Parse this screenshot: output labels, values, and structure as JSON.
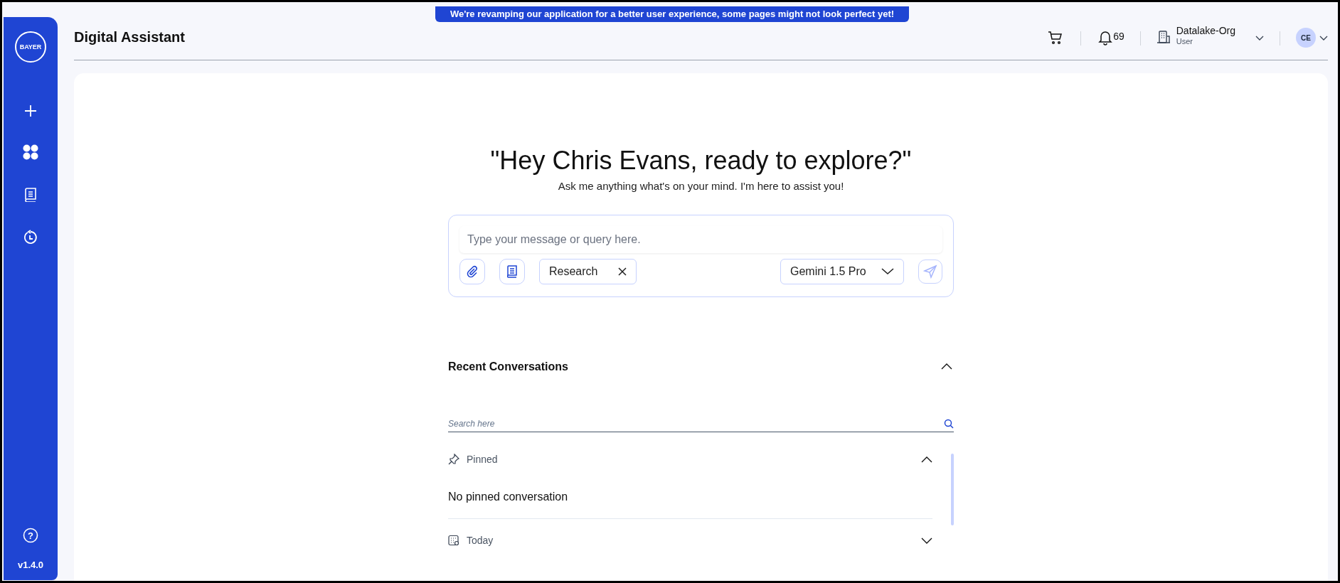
{
  "banner": "We're revamping our application for a better user experience, some pages might not look perfect yet!",
  "sidebar": {
    "logo": "BAYER",
    "help": "?",
    "version": "v1.4.0"
  },
  "header": {
    "title": "Digital Assistant",
    "notifications": "69",
    "org": {
      "name": "Datalake-Org",
      "role": "User"
    },
    "avatar": "CE"
  },
  "hero": {
    "title": "\"Hey Chris Evans, ready to explore?\"",
    "subtitle": "Ask me anything what's on your mind. I'm here to assist you!"
  },
  "composer": {
    "placeholder": "Type your message or query here.",
    "chip": "Research",
    "model": "Gemini 1.5 Pro"
  },
  "recent": {
    "title": "Recent Conversations",
    "expanded": true,
    "search_placeholder": "Search here",
    "groups": [
      {
        "kind": "pinned",
        "label": "Pinned",
        "expanded": true,
        "empty_text": "No pinned conversation"
      },
      {
        "kind": "today",
        "label": "Today",
        "expanded": false
      }
    ]
  }
}
